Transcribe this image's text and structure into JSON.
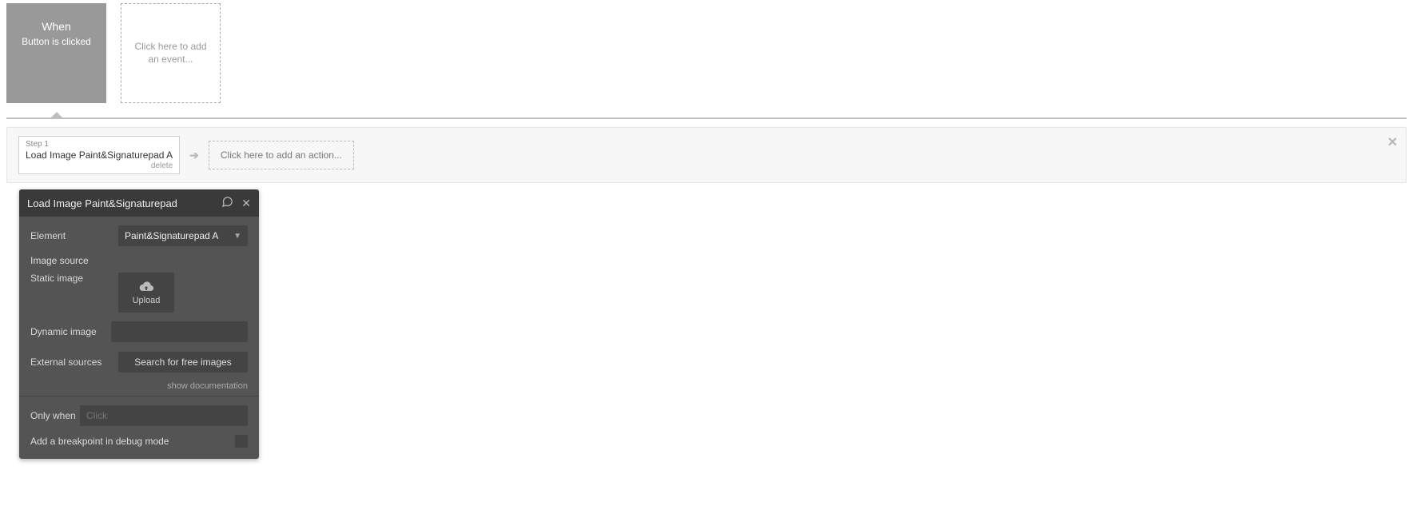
{
  "events": {
    "selected": {
      "title": "When",
      "subtitle": "Button is clicked"
    },
    "add_event_text": "Click here to add an event..."
  },
  "actions": {
    "step": {
      "stepLabel": "Step 1",
      "text": "Load Image Paint&Signaturepad A",
      "deleteLabel": "delete"
    },
    "add_action_text": "Click here to add an action..."
  },
  "panel": {
    "title": "Load Image Paint&Signaturepad",
    "rows": {
      "element_label": "Element",
      "element_value": "Paint&Signaturepad A",
      "image_source_label": "Image source",
      "static_image_label": "Static image",
      "upload_label": "Upload",
      "dynamic_image_label": "Dynamic image",
      "external_sources_label": "External sources",
      "search_button": "Search for free images",
      "show_doc": "show documentation",
      "only_when_label": "Only when",
      "only_when_placeholder": "Click",
      "breakpoint_label": "Add a breakpoint in debug mode"
    }
  }
}
